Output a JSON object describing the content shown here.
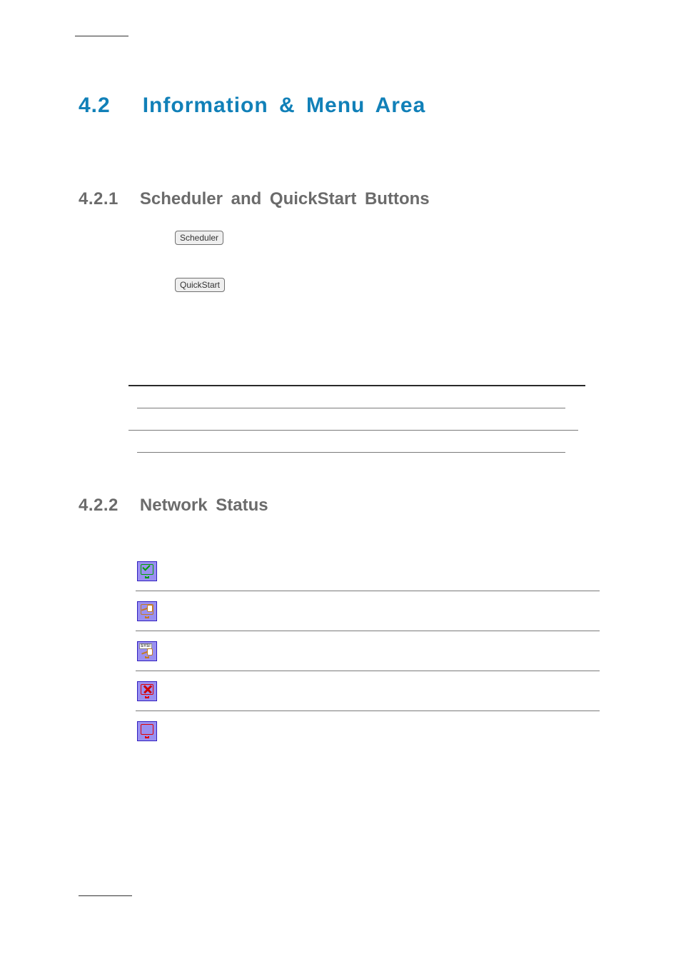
{
  "section": {
    "number": "4.2",
    "title": "Information & Menu Area"
  },
  "subsections": [
    {
      "number": "4.2.1",
      "title": "Scheduler and QuickStart Buttons"
    },
    {
      "number": "4.2.2",
      "title": "Network Status"
    }
  ],
  "buttons": {
    "scheduler": "Scheduler",
    "quickstart": "QuickStart"
  },
  "network_status_icons": [
    {
      "name": "connected-ok",
      "description": ""
    },
    {
      "name": "plugged",
      "description": ""
    },
    {
      "name": "sys-plugged",
      "description": ""
    },
    {
      "name": "disconnected",
      "description": ""
    },
    {
      "name": "monitor-off",
      "description": ""
    }
  ]
}
